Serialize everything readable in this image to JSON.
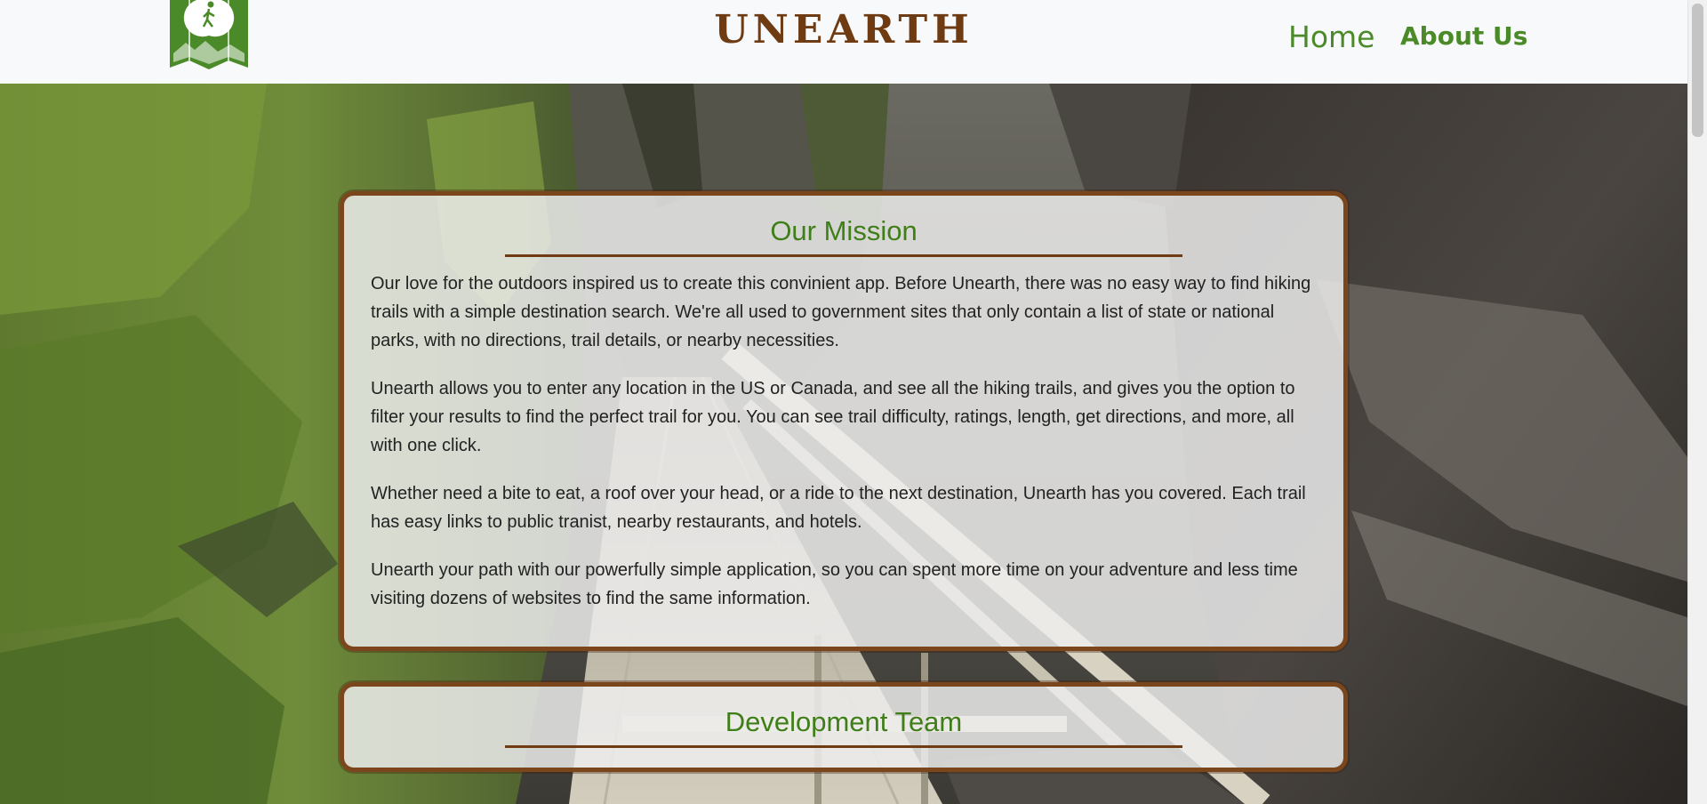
{
  "brand": {
    "name": "UNEARTH",
    "logo_icon": "hiker-map-icon",
    "brand_color": "#6e3b13"
  },
  "nav": {
    "items": [
      {
        "label": "Home"
      },
      {
        "label": "About Us"
      }
    ],
    "accent_color": "#4b8a28"
  },
  "mission": {
    "title": "Our Mission",
    "paragraphs": [
      "Our love for the outdoors inspired us to create this convinient app. Before Unearth, there was no easy way to find hiking trails with a simple destination search. We're all used to government sites that only contain a list of state or national parks, with no directions, trail details, or nearby necessities.",
      "Unearth allows you to enter any location in the US or Canada, and see all the hiking trails, and gives you the option to filter your results to find the perfect trail for you. You can see trail difficulty, ratings, length, get directions, and more, all with one click.",
      "Whether need a bite to eat, a roof over your head, or a ride to the next destination, Unearth has you covered. Each trail has easy links to public tranist, nearby restaurants, and hotels.",
      "Unearth your path with our powerfully simple application, so you can spent more time on your adventure and less time visiting dozens of websites to find the same information."
    ]
  },
  "team": {
    "title": "Development Team"
  },
  "colors": {
    "card_border": "#7b461c",
    "heading_green": "#3f7e18"
  }
}
